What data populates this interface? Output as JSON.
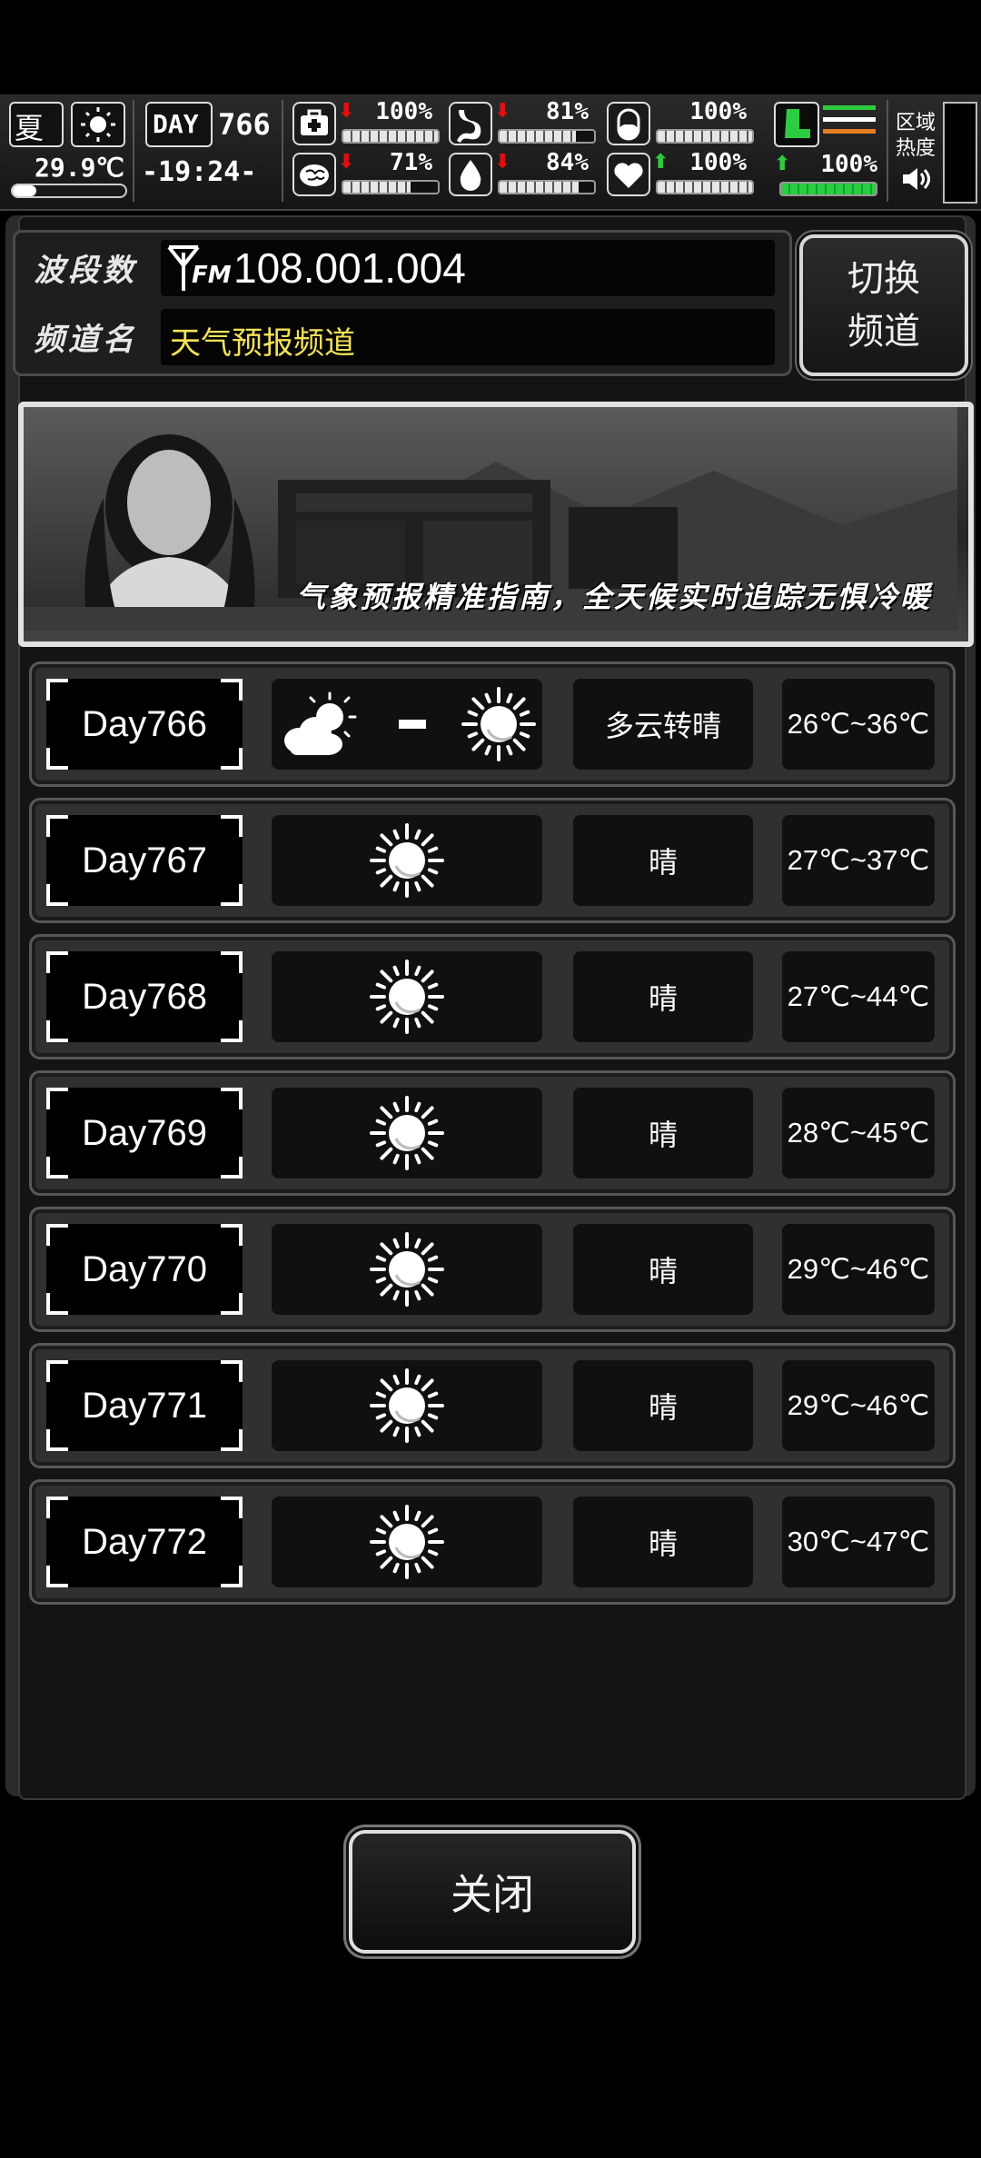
{
  "hud": {
    "season": "夏",
    "temperature": "29.9℃",
    "day_label": "DAY",
    "day_number": "766",
    "time": "-19:24-",
    "stats": [
      {
        "name": "health",
        "icon": "medkit-icon",
        "arrow": "down",
        "value": "100%",
        "level": 1.0
      },
      {
        "name": "hunger",
        "icon": "stomach-icon",
        "arrow": "down",
        "value": "81%",
        "level": 0.81
      },
      {
        "name": "pill",
        "icon": "pill-icon",
        "arrow": "none",
        "value": "100%",
        "level": 1.0
      },
      {
        "name": "sanity",
        "icon": "brain-icon",
        "arrow": "down",
        "value": "71%",
        "level": 0.71
      },
      {
        "name": "thirst",
        "icon": "water-drop-icon",
        "arrow": "down",
        "value": "84%",
        "level": 0.84
      },
      {
        "name": "mood",
        "icon": "heart-icon",
        "arrow": "up",
        "value": "100%",
        "level": 1.0
      }
    ],
    "stamina": {
      "arrow": "up",
      "value": "100%",
      "level": 1.0
    },
    "region_heat_label": "区域热度",
    "arrow_colors": {
      "down": "#e01010",
      "up": "#2ecc40"
    }
  },
  "channel": {
    "band_label": "波段数",
    "band_value": "108.001.004",
    "fm_label": "FM",
    "name_label": "频道名",
    "name_value": "天气预报频道",
    "name_color": "#f2e25a"
  },
  "switch_button": {
    "line1": "切换",
    "line2": "频道"
  },
  "banner": {
    "caption": "气象预报精准指南，全天候实时追踪无惧冷暖"
  },
  "forecast": [
    {
      "day": "Day766",
      "icons": [
        "partly-cloudy-icon",
        "sun-icon"
      ],
      "condition": "多云转晴",
      "temp": "26℃~36℃"
    },
    {
      "day": "Day767",
      "icons": [
        "sun-icon"
      ],
      "condition": "晴",
      "temp": "27℃~37℃"
    },
    {
      "day": "Day768",
      "icons": [
        "sun-icon"
      ],
      "condition": "晴",
      "temp": "27℃~44℃"
    },
    {
      "day": "Day769",
      "icons": [
        "sun-icon"
      ],
      "condition": "晴",
      "temp": "28℃~45℃"
    },
    {
      "day": "Day770",
      "icons": [
        "sun-icon"
      ],
      "condition": "晴",
      "temp": "29℃~46℃"
    },
    {
      "day": "Day771",
      "icons": [
        "sun-icon"
      ],
      "condition": "晴",
      "temp": "29℃~46℃"
    },
    {
      "day": "Day772",
      "icons": [
        "sun-icon"
      ],
      "condition": "晴",
      "temp": "30℃~47℃"
    }
  ],
  "close_button": "关闭"
}
